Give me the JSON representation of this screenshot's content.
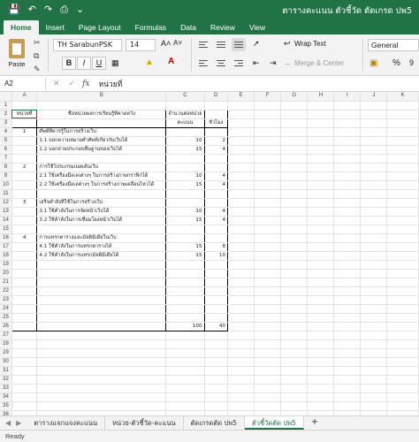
{
  "window": {
    "doc_title": "ตารางคะแนน ตัวชี้วัด ตัดเกรด ปพ5",
    "quick_access": [
      "save-icon",
      "undo-icon",
      "redo-icon",
      "print-icon",
      "customize-icon"
    ]
  },
  "tabs": [
    "Home",
    "Insert",
    "Page Layout",
    "Formulas",
    "Data",
    "Review",
    "View"
  ],
  "ribbon": {
    "paste_label": "Paste",
    "font_name": "TH SarabunPSK",
    "font_size": "14",
    "bold": "B",
    "italic": "I",
    "underline": "U",
    "wrap_text": "Wrap Text",
    "merge_center": "Merge & Center",
    "number_format": "General"
  },
  "formula_bar": {
    "name_box": "A2",
    "fx": "fx",
    "content": "หน่วยที่"
  },
  "columns": [
    "A",
    "B",
    "C",
    "D",
    "E",
    "F",
    "G",
    "H",
    "I",
    "J",
    "K"
  ],
  "rows": [
    {
      "n": "1",
      "a": "",
      "b": "",
      "c": "",
      "d": ""
    },
    {
      "n": "2",
      "a": "หน่วยที่",
      "b": "ชื่อหน่วยผลการเรียนรู้ที่คาดหวัง",
      "c": "จำนวนต่อหน่วย",
      "d": ""
    },
    {
      "n": "3",
      "a": "",
      "b": "",
      "c": "คะแนน",
      "d": "ชั่วโมง"
    },
    {
      "n": "4",
      "a": "1",
      "b": "ศัพท์ที่ควรรู้ในการสร้างเว็บ",
      "c": "",
      "d": ""
    },
    {
      "n": "5",
      "a": "",
      "b": "1.1 บอกความหมายคำศัพท์เกี่ยวกับเว็บได้",
      "c": "10",
      "d": "2"
    },
    {
      "n": "6",
      "a": "",
      "b": "1.2 บอกส่วนประกอบพื้นฐานของเว็บได้",
      "c": "15",
      "d": "4"
    },
    {
      "n": "7",
      "a": "",
      "b": "",
      "c": "",
      "d": ""
    },
    {
      "n": "8",
      "a": "2",
      "b": "การใช้โปรแกรมเนตเด้นเว็บ",
      "c": "",
      "d": ""
    },
    {
      "n": "9",
      "a": "",
      "b": "2.1 ใช้เครื่องมือเลเต่างๆ ในการสร้างภาพกราฟิกได้",
      "c": "10",
      "d": "4"
    },
    {
      "n": "10",
      "a": "",
      "b": "2.2 ใช้เครื่องมือเลต่างๆ ในการสร้างภาพเคลื่อนไหวได้",
      "c": "15",
      "d": "4"
    },
    {
      "n": "11",
      "a": "",
      "b": "",
      "c": "",
      "d": ""
    },
    {
      "n": "12",
      "a": "3",
      "b": "เสร็จคำสั่งที่ใช้ในการสร้างเว็บ",
      "c": "",
      "d": ""
    },
    {
      "n": "13",
      "a": "",
      "b": "3.1 ใช้คำสั่งในการจัดหน้าเว็บได้",
      "c": "10",
      "d": "4"
    },
    {
      "n": "14",
      "a": "",
      "b": "3.2 ใช้คำสั่งในการเชื่อมโยงหน้าเว็บได้",
      "c": "15",
      "d": "4"
    },
    {
      "n": "15",
      "a": "",
      "b": "",
      "c": "",
      "d": ""
    },
    {
      "n": "16",
      "a": "4",
      "b": "การแทรกตารางและมัลติมีเดียในเว็บ",
      "c": "",
      "d": ""
    },
    {
      "n": "17",
      "a": "",
      "b": "4.1 ใช้คำสั่งในการแทรกตารางได้",
      "c": "15",
      "d": "8"
    },
    {
      "n": "18",
      "a": "",
      "b": "4.2 ใช้คำสั่งในการแทรกมัลติมีเดียได้",
      "c": "15",
      "d": "10"
    },
    {
      "n": "19",
      "a": "",
      "b": "",
      "c": "",
      "d": ""
    },
    {
      "n": "20",
      "a": "",
      "b": "",
      "c": "",
      "d": ""
    },
    {
      "n": "21",
      "a": "",
      "b": "",
      "c": "",
      "d": ""
    },
    {
      "n": "22",
      "a": "",
      "b": "",
      "c": "",
      "d": ""
    },
    {
      "n": "23",
      "a": "",
      "b": "",
      "c": "",
      "d": ""
    },
    {
      "n": "24",
      "a": "",
      "b": "",
      "c": "",
      "d": ""
    },
    {
      "n": "25",
      "a": "",
      "b": "",
      "c": "",
      "d": ""
    },
    {
      "n": "26",
      "a": "",
      "b": "",
      "c": "100",
      "d": "40"
    },
    {
      "n": "27",
      "a": "",
      "b": "",
      "c": "",
      "d": ""
    },
    {
      "n": "28",
      "a": "",
      "b": "",
      "c": "",
      "d": ""
    },
    {
      "n": "29",
      "a": "",
      "b": "",
      "c": "",
      "d": ""
    },
    {
      "n": "30",
      "a": "",
      "b": "",
      "c": "",
      "d": ""
    },
    {
      "n": "31",
      "a": "",
      "b": "",
      "c": "",
      "d": ""
    },
    {
      "n": "32",
      "a": "",
      "b": "",
      "c": "",
      "d": ""
    },
    {
      "n": "33",
      "a": "",
      "b": "",
      "c": "",
      "d": ""
    },
    {
      "n": "34",
      "a": "",
      "b": "",
      "c": "",
      "d": ""
    },
    {
      "n": "35",
      "a": "",
      "b": "",
      "c": "",
      "d": ""
    },
    {
      "n": "36",
      "a": "",
      "b": "",
      "c": "",
      "d": ""
    },
    {
      "n": "37",
      "a": "",
      "b": "",
      "c": "",
      "d": ""
    }
  ],
  "sheets": [
    "ตารางแจกแจงคะแนน",
    "หน่วย-ตัวชี้วัด-คะแนน",
    "ตัดเกรดตัด ปพ5",
    "ตัวชี้วัดตัด ปพ5"
  ],
  "active_sheet_index": 3,
  "status": "Ready",
  "colors": {
    "accent": "#217346",
    "ribbon_bg": "#f3f3f3"
  }
}
